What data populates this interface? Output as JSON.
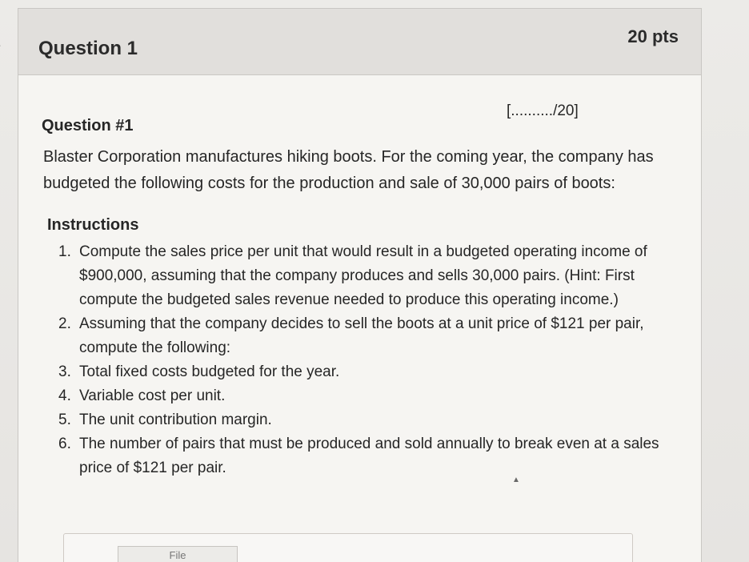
{
  "question": {
    "title": "Question 1",
    "points": "20 pts",
    "number_label": "Question #1",
    "score_blank": "[........../20]",
    "description": "Blaster Corporation manufactures hiking boots. For the coming year, the company has budgeted the following costs for the production and sale of 30,000 pairs of boots:",
    "instructions_heading": "Instructions",
    "instructions": [
      {
        "number": "1.",
        "text": "Compute the sales price per unit that would result in a budgeted operating income of $900,000, assuming that the company produces and sells 30,000 pairs. (Hint: First compute the budgeted sales revenue needed to produce this operating income.)"
      },
      {
        "number": "2.",
        "text": "Assuming that the company decides to sell the boots at a unit price of $121 per pair, compute the following:"
      },
      {
        "number": "3.",
        "text": "Total fixed costs budgeted for the year."
      },
      {
        "number": "4.",
        "text": "Variable cost per unit."
      },
      {
        "number": "5.",
        "text": "The unit contribution margin."
      },
      {
        "number": "6.",
        "text": "The number of pairs that must be produced and sold annually to break even at a sales price of $121 per pair."
      }
    ]
  },
  "upload": {
    "button_label": "File"
  },
  "icons": {
    "collapse": "chevron-right-icon",
    "cursor": "cursor-icon"
  }
}
